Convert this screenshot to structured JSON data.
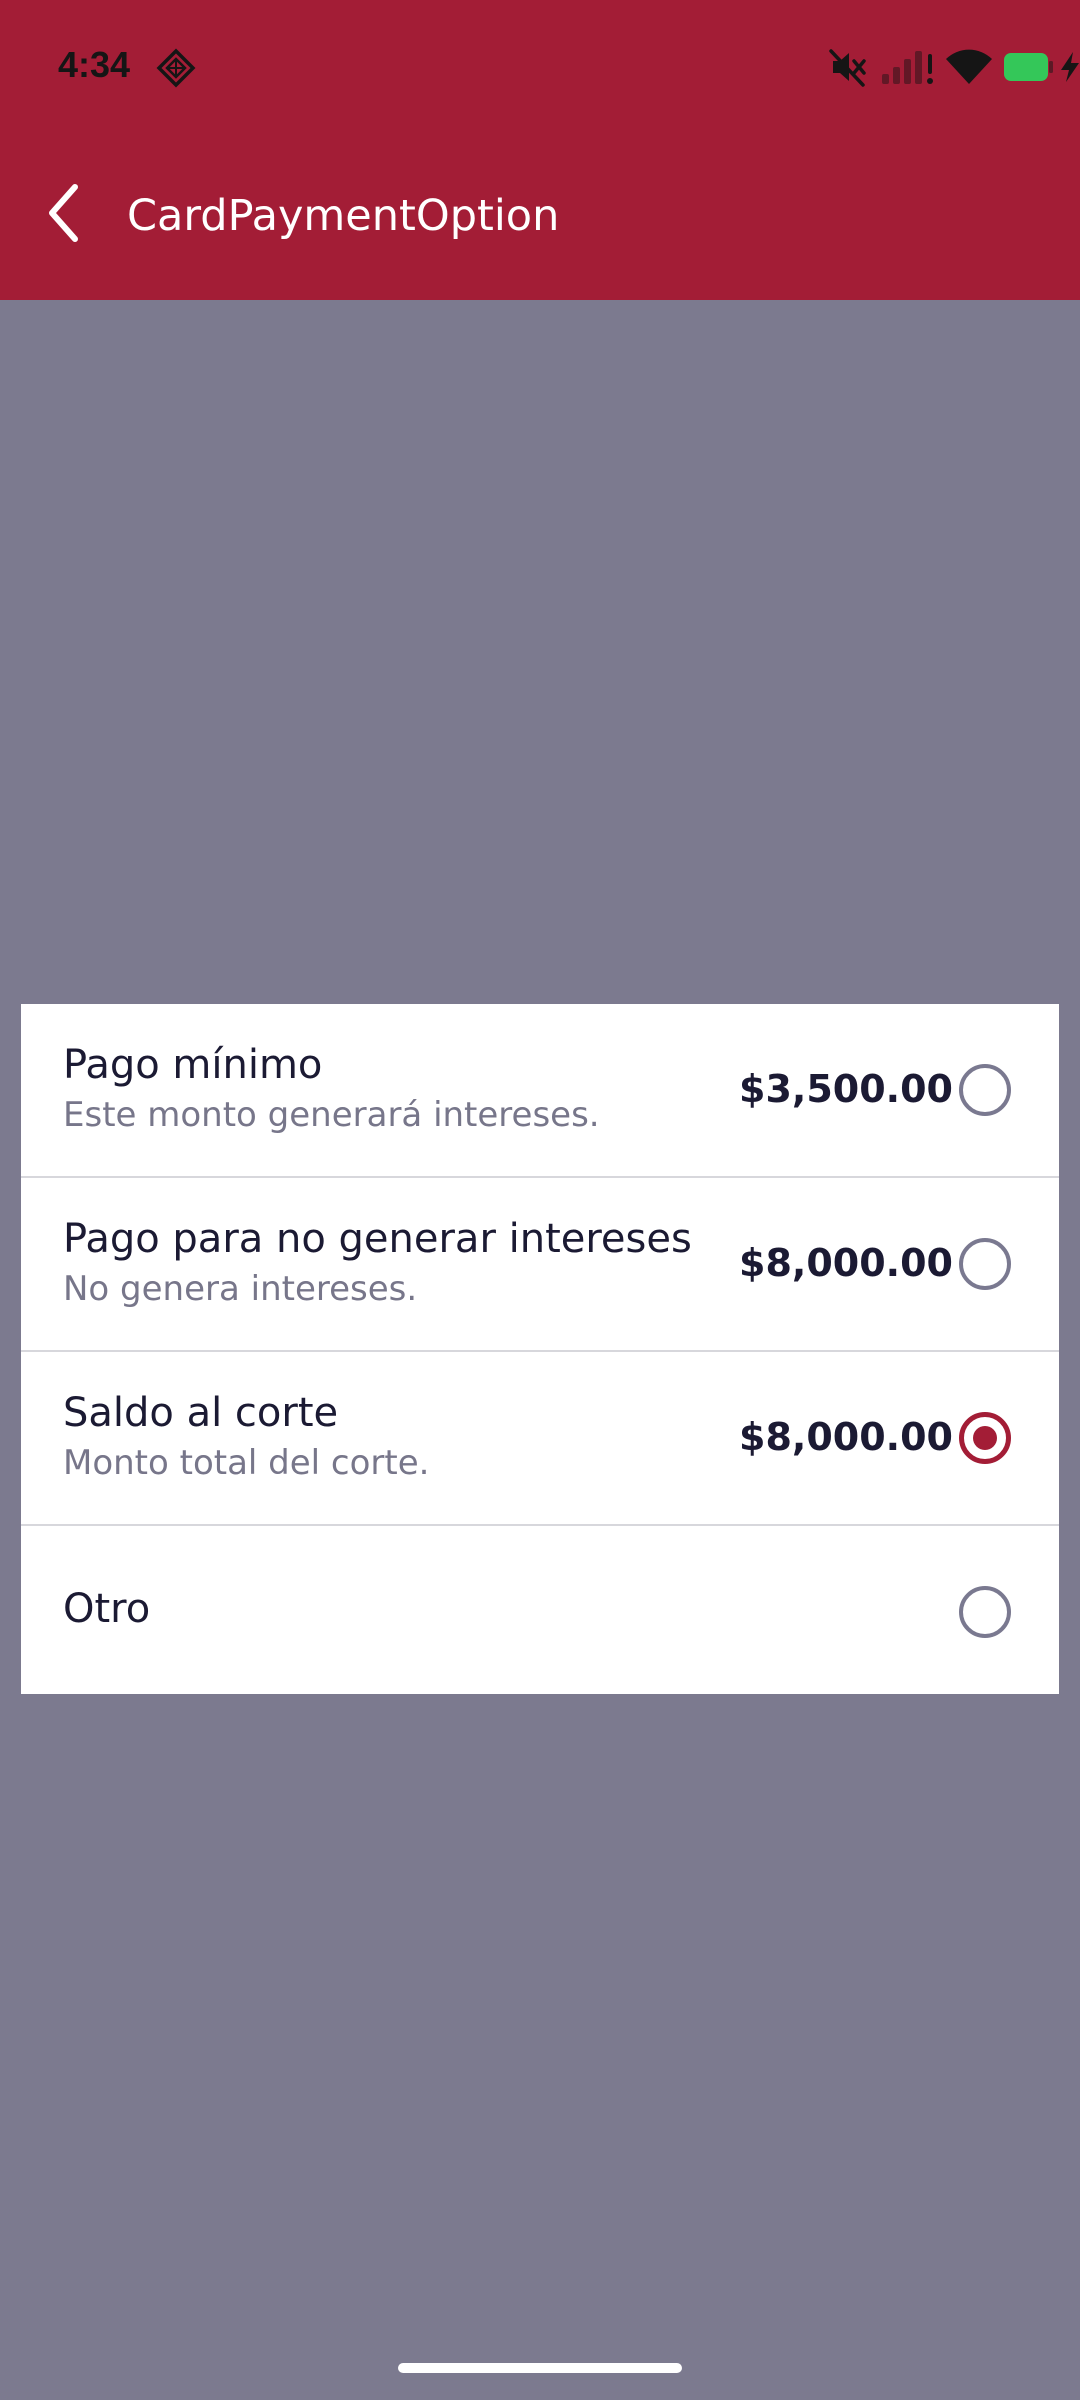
{
  "status_bar": {
    "time": "4:34",
    "app_icon": "diamond-app-icon",
    "icons": [
      "mute-icon",
      "signal-icon",
      "wifi-icon",
      "battery-icon",
      "charging-icon"
    ],
    "battery_color": "#34c759"
  },
  "header": {
    "title": "CardPaymentOption",
    "back_icon": "chevron-left-icon",
    "background_color": "#a31d36"
  },
  "overlay_color": "#7c7a8f",
  "options": [
    {
      "title": "Pago mínimo",
      "subtitle": "Este monto generará intereses.",
      "amount": "$3,500.00",
      "selected": false
    },
    {
      "title": "Pago para no generar intereses",
      "subtitle": "No genera intereses.",
      "amount": "$8,000.00",
      "selected": false
    },
    {
      "title": "Saldo al corte",
      "subtitle": "Monto total del corte.",
      "amount": "$8,000.00",
      "selected": true
    },
    {
      "title": "Otro",
      "subtitle": "",
      "amount": "",
      "selected": false
    }
  ],
  "accent_color": "#a31d36"
}
